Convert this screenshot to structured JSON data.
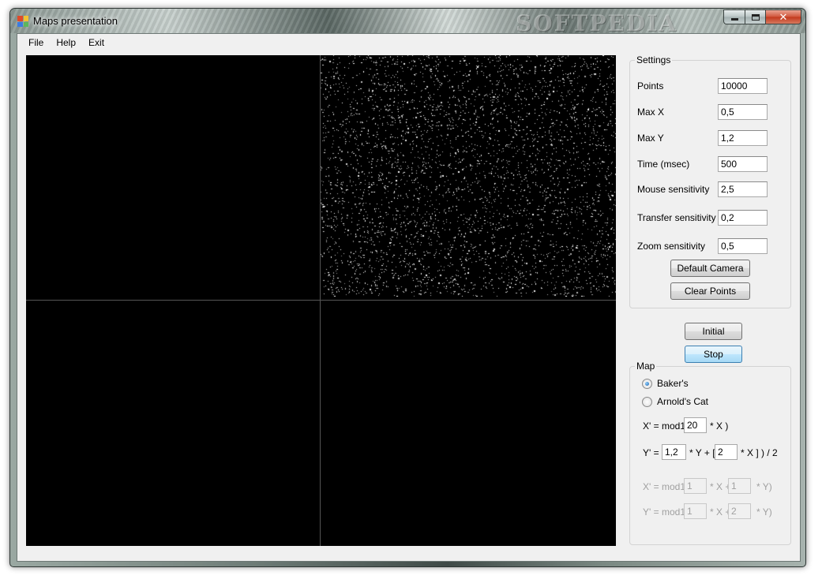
{
  "window": {
    "title": "Maps presentation",
    "watermark": "SOFTPEDIA",
    "close_glyph": "✕"
  },
  "menu": [
    "File",
    "Help",
    "Exit"
  ],
  "settings": {
    "label": "Settings",
    "fields": [
      {
        "label": "Points",
        "value": "10000"
      },
      {
        "label": "Max X",
        "value": "0,5"
      },
      {
        "label": "Max Y",
        "value": "1,2"
      },
      {
        "label": "Time (msec)",
        "value": "500"
      },
      {
        "label": "Mouse sensitivity",
        "value": "2,5"
      },
      {
        "label": "Transfer sensitivity",
        "value": "0,2"
      },
      {
        "label": "Zoom sensitivity",
        "value": "0,5"
      }
    ],
    "default_camera_label": "Default Camera",
    "clear_points_label": "Clear Points"
  },
  "controls": {
    "initial_label": "Initial",
    "stop_label": "Stop"
  },
  "map": {
    "label": "Map",
    "options": [
      {
        "label": "Baker's",
        "checked": true
      },
      {
        "label": "Arnold's Cat",
        "checked": false
      }
    ],
    "baker": {
      "x_prefix": "X' = mod1(",
      "x_value": "20",
      "x_suffix": "* X )",
      "y_prefix": "Y' = (",
      "y_value1": "1,2",
      "y_mid": "* Y + [",
      "y_value2": "2",
      "y_suffix": "* X ] ) / 2"
    },
    "cat": {
      "x_prefix": "X' = mod1(",
      "x_value1": "1",
      "x_mid": "* X +",
      "x_value2": "1",
      "x_suffix": "* Y)",
      "y_prefix": "Y' = mod1(",
      "y_value1": "1",
      "y_mid": "* X +",
      "y_value2": "2",
      "y_suffix": "* Y)"
    }
  },
  "viewport": {
    "background": "#000000",
    "point_color": "#ffffff",
    "active_quadrant": "top-right"
  }
}
